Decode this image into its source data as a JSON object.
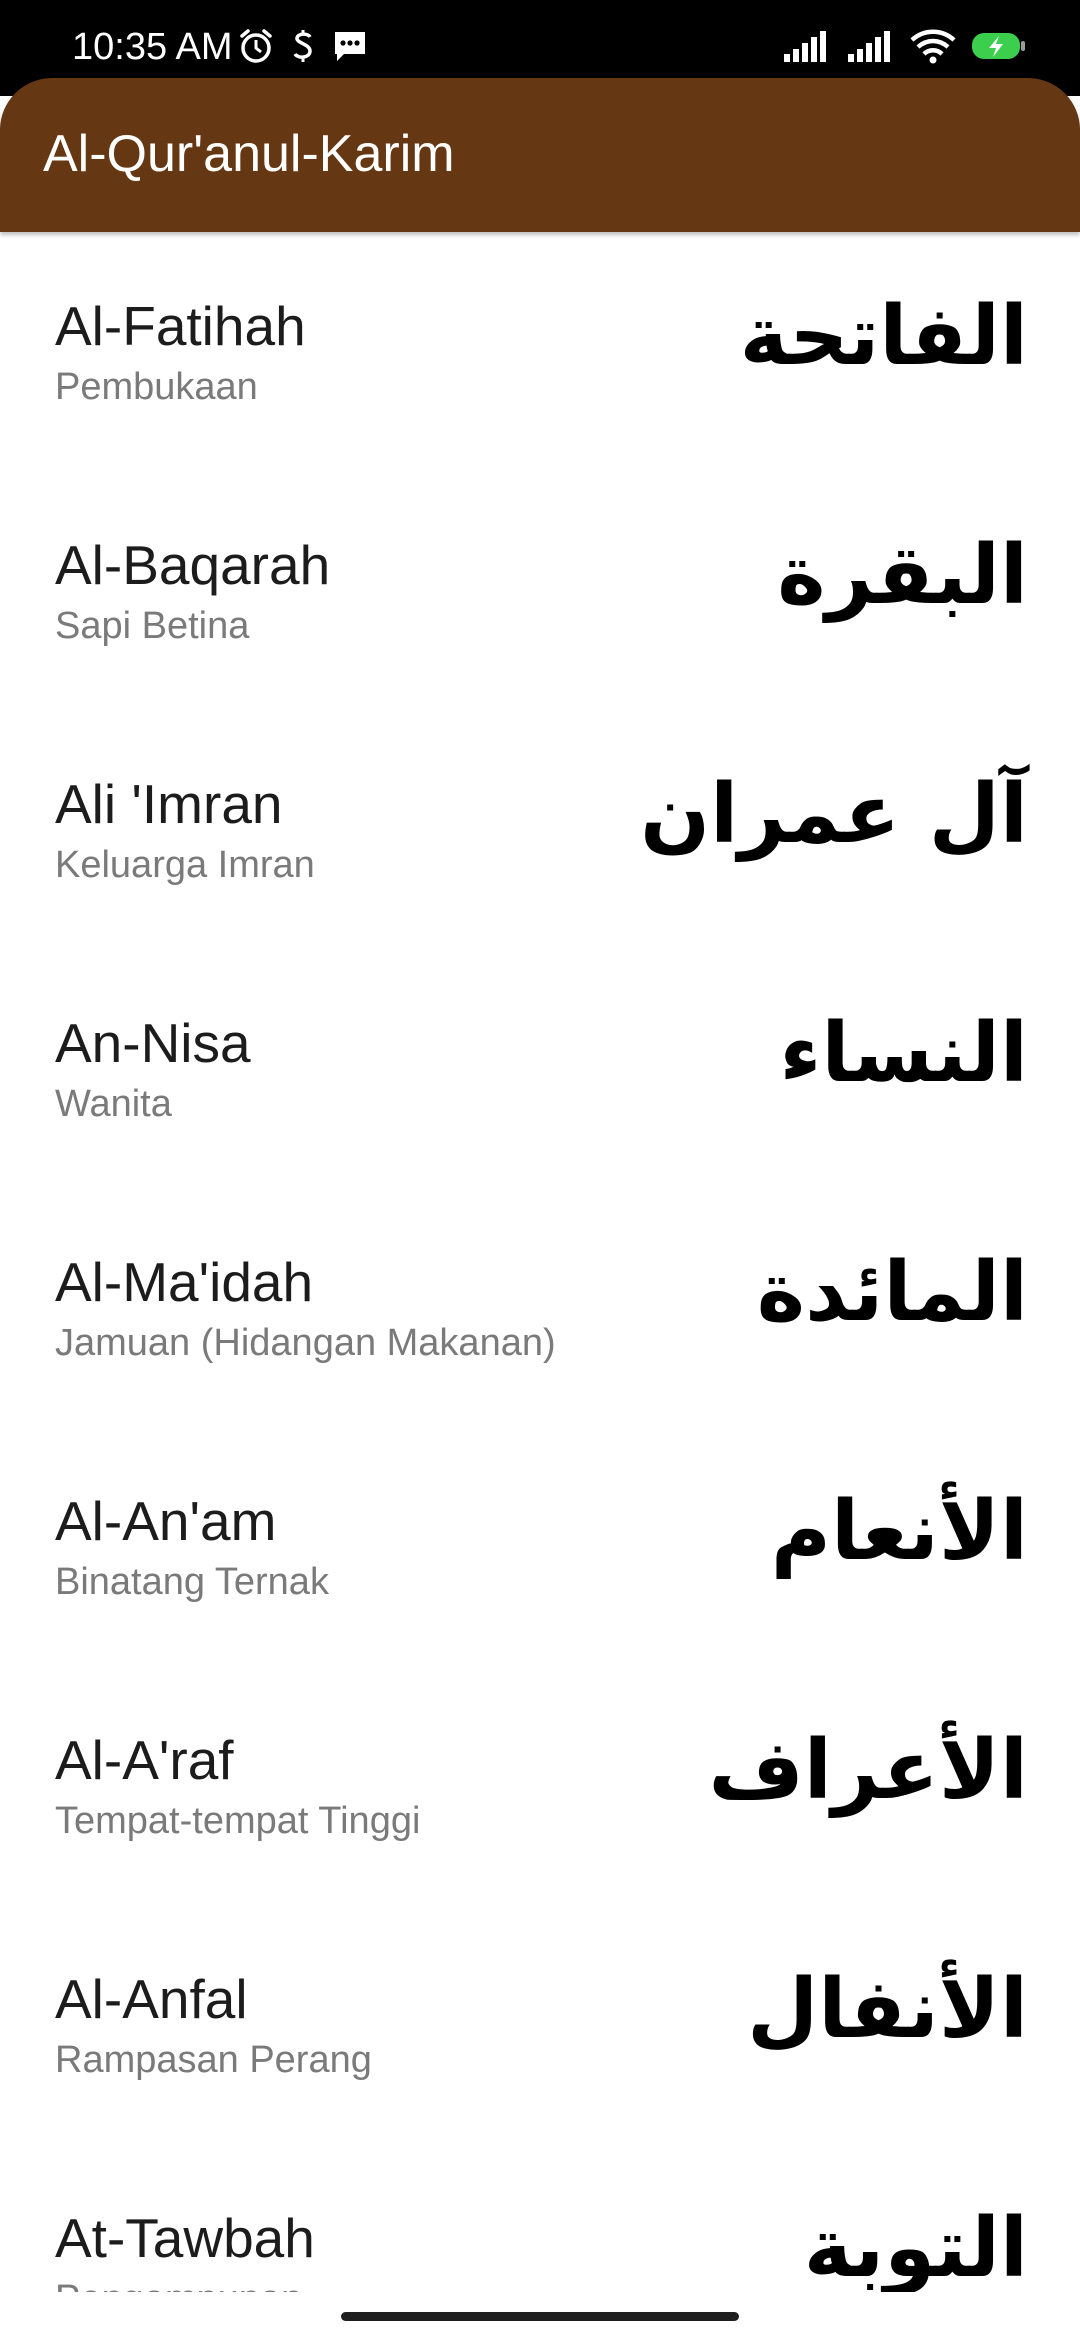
{
  "status_bar": {
    "time": "10:35 AM",
    "left_icons": [
      "alarm-icon",
      "s-notification-icon",
      "message-icon"
    ],
    "right_icons": [
      "signal-icon",
      "signal-icon",
      "wifi-icon",
      "battery-charging-icon"
    ],
    "battery_color": "#3ccf4e"
  },
  "app_bar": {
    "title": "Al-Qur'anul-Karim",
    "color": "#653712"
  },
  "surahs": [
    {
      "name": "Al-Fatihah",
      "meaning": "Pembukaan",
      "arabic": "الفاتحة"
    },
    {
      "name": "Al-Baqarah",
      "meaning": "Sapi Betina",
      "arabic": "البقرة"
    },
    {
      "name": "Ali 'Imran",
      "meaning": "Keluarga Imran",
      "arabic": "آل عمران"
    },
    {
      "name": "An-Nisa",
      "meaning": "Wanita",
      "arabic": "النساء"
    },
    {
      "name": "Al-Ma'idah",
      "meaning": "Jamuan (Hidangan Makanan)",
      "arabic": "المائدة"
    },
    {
      "name": "Al-An'am",
      "meaning": "Binatang Ternak",
      "arabic": "الأنعام"
    },
    {
      "name": "Al-A'raf",
      "meaning": "Tempat-tempat Tinggi",
      "arabic": "الأعراف"
    },
    {
      "name": "Al-Anfal",
      "meaning": "Rampasan Perang",
      "arabic": "الأنفال"
    },
    {
      "name": "At-Tawbah",
      "meaning": "Pengampunan",
      "arabic": "التوبة"
    }
  ]
}
